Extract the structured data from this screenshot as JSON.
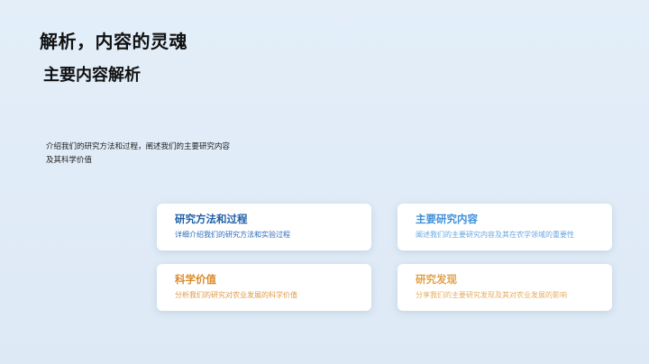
{
  "slide": {
    "title": "解析，内容的灵魂",
    "subtitle": "主要内容解析",
    "intro": "介绍我们的研究方法和过程，阐述我们的主要研究内容及其科学价值"
  },
  "cards": [
    {
      "title": "研究方法和过程",
      "desc": "详细介绍我们的研究方法和实验过程",
      "title_color": "#1f5fa8"
    },
    {
      "title": "主要研究内容",
      "desc": "阐述我们的主要研究内容及其在农学领域的重要性",
      "title_color": "#3f8fd9"
    },
    {
      "title": "科学价值",
      "desc": "分析我们的研究对农业发展的科学价值",
      "title_color": "#d98a2a"
    },
    {
      "title": "研究发现",
      "desc": "分享我们的主要研究发现及其对农业发展的影响",
      "title_color": "#e0a24a"
    }
  ]
}
